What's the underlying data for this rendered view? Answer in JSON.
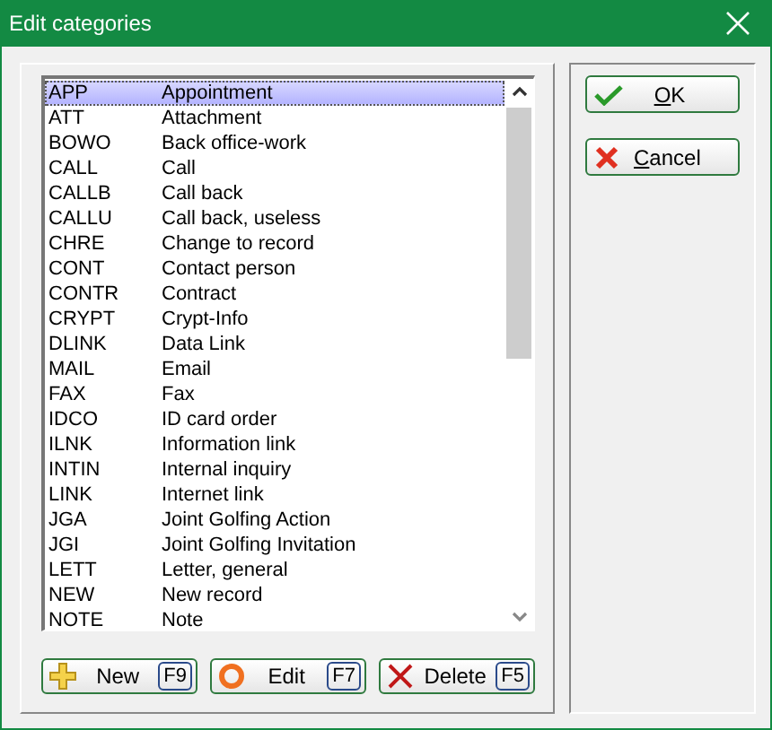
{
  "window": {
    "title": "Edit categories"
  },
  "list": {
    "rows": [
      {
        "code": "APP",
        "name": "Appointment",
        "selected": true
      },
      {
        "code": "ATT",
        "name": "Attachment",
        "selected": false
      },
      {
        "code": "BOWO",
        "name": "Back office-work",
        "selected": false
      },
      {
        "code": "CALL",
        "name": "Call",
        "selected": false
      },
      {
        "code": "CALLB",
        "name": "Call back",
        "selected": false
      },
      {
        "code": "CALLU",
        "name": "Call back, useless",
        "selected": false
      },
      {
        "code": "CHRE",
        "name": "Change to record",
        "selected": false
      },
      {
        "code": "CONT",
        "name": "Contact person",
        "selected": false
      },
      {
        "code": "CONTR",
        "name": "Contract",
        "selected": false
      },
      {
        "code": "CRYPT",
        "name": "Crypt-Info",
        "selected": false
      },
      {
        "code": "DLINK",
        "name": "Data Link",
        "selected": false
      },
      {
        "code": "MAIL",
        "name": "Email",
        "selected": false
      },
      {
        "code": "FAX",
        "name": "Fax",
        "selected": false
      },
      {
        "code": "IDCO",
        "name": "ID card order",
        "selected": false
      },
      {
        "code": "ILNK",
        "name": "Information link",
        "selected": false
      },
      {
        "code": "INTIN",
        "name": "Internal inquiry",
        "selected": false
      },
      {
        "code": "LINK",
        "name": "Internet link",
        "selected": false
      },
      {
        "code": "JGA",
        "name": "Joint Golfing Action",
        "selected": false
      },
      {
        "code": "JGI",
        "name": "Joint Golfing Invitation",
        "selected": false
      },
      {
        "code": "LETT",
        "name": "Letter, general",
        "selected": false
      },
      {
        "code": "NEW",
        "name": "New record",
        "selected": false
      },
      {
        "code": "NOTE",
        "name": "Note",
        "selected": false
      }
    ]
  },
  "actions": [
    {
      "kind": "new",
      "label": "New",
      "key": "F9"
    },
    {
      "kind": "edit",
      "label": "Edit",
      "key": "F7"
    },
    {
      "kind": "delete",
      "label": "Delete",
      "key": "F5"
    }
  ],
  "dialog_buttons": [
    {
      "kind": "ok",
      "label": "OK"
    },
    {
      "kind": "cancel",
      "label": "Cancel"
    }
  ]
}
